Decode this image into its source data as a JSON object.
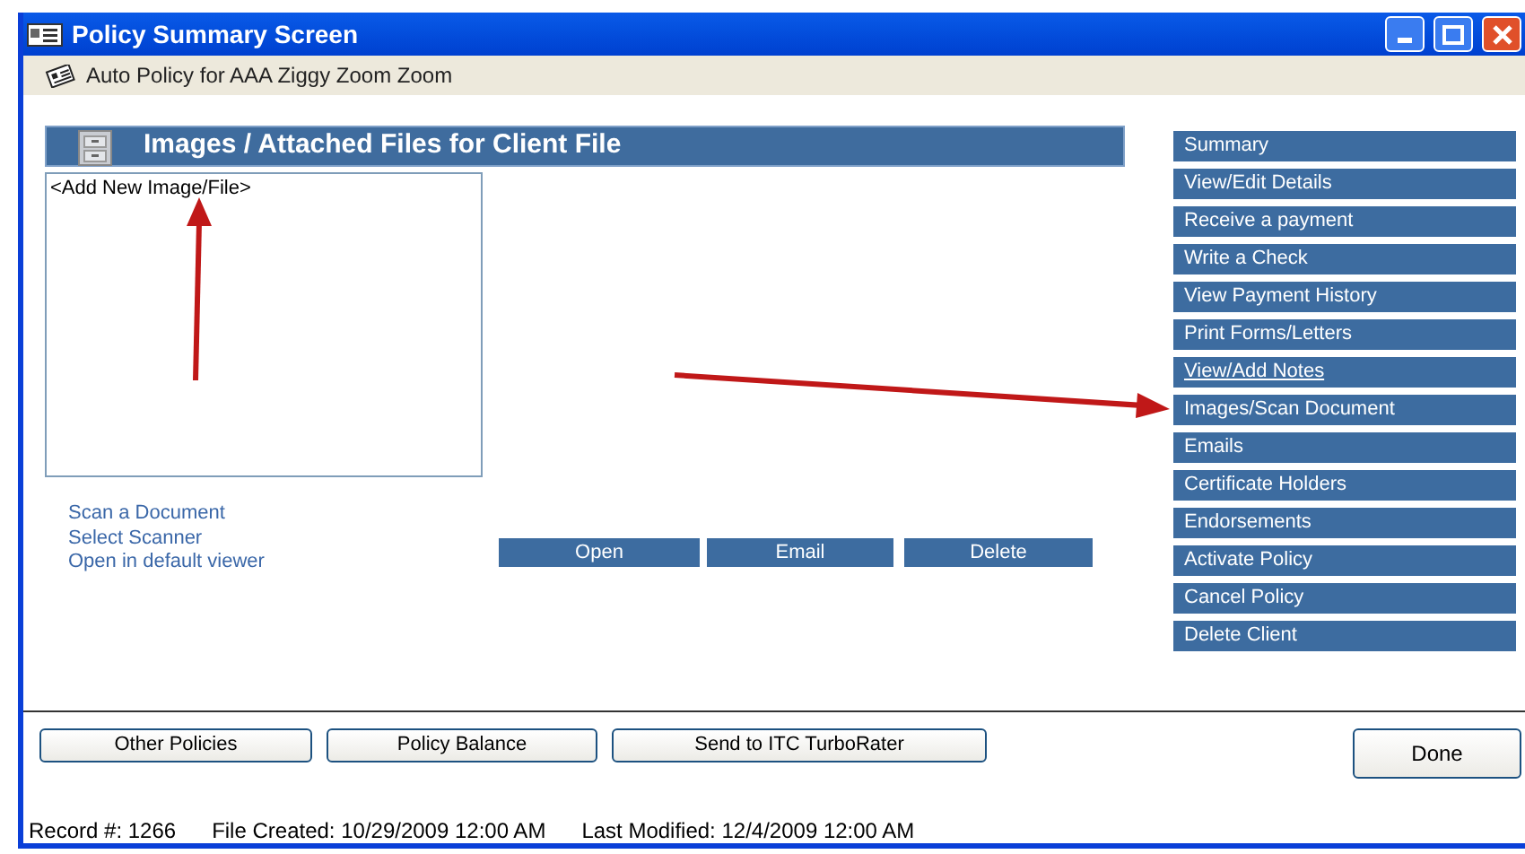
{
  "window": {
    "title": "Policy Summary Screen"
  },
  "policy_header": "Auto Policy for AAA Ziggy Zoom Zoom",
  "panel": {
    "title": "Images / Attached Files for Client File",
    "files": [
      "<Add New Image/File>"
    ]
  },
  "links": [
    "Scan a Document",
    "Select Scanner",
    "Open in default viewer"
  ],
  "file_buttons": [
    "Open",
    "Email",
    "Delete"
  ],
  "menu": [
    {
      "label": "Summary",
      "underlined": false
    },
    {
      "label": "View/Edit Details",
      "underlined": false
    },
    {
      "label": "Receive a payment",
      "underlined": false
    },
    {
      "label": "Write a Check",
      "underlined": false
    },
    {
      "label": "View Payment History",
      "underlined": false
    },
    {
      "label": "Print Forms/Letters",
      "underlined": false
    },
    {
      "label": "View/Add Notes",
      "underlined": true
    },
    {
      "label": "Images/Scan Document",
      "underlined": false
    },
    {
      "label": "Emails",
      "underlined": false
    },
    {
      "label": "Certificate Holders",
      "underlined": false
    },
    {
      "label": "Endorsements",
      "underlined": false
    },
    {
      "label": "Activate Policy",
      "underlined": false
    },
    {
      "label": "Cancel Policy",
      "underlined": false
    },
    {
      "label": "Delete Client",
      "underlined": false
    }
  ],
  "bottom_buttons": [
    "Other Policies",
    "Policy Balance",
    "Send to ITC TurboRater"
  ],
  "done_button": "Done",
  "status_bar": [
    "Record #: 1266",
    "File Created: 10/29/2009 12:00 AM",
    "Last Modified: 12/4/2009 12:00 AM"
  ]
}
